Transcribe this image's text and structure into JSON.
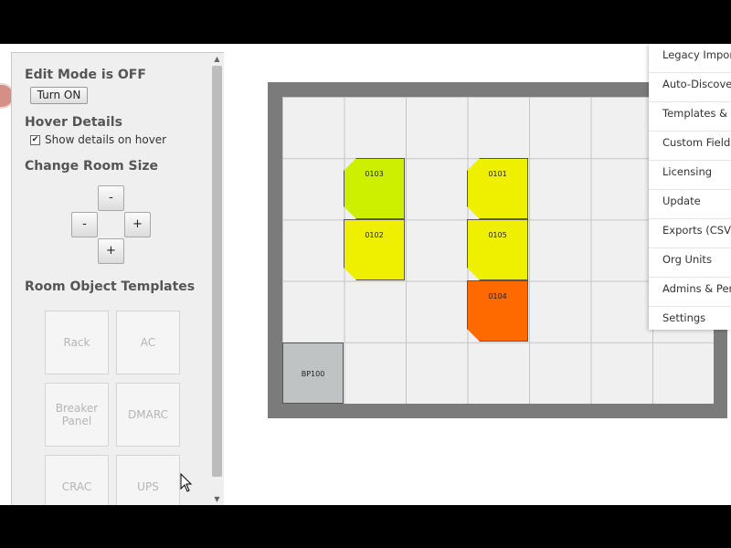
{
  "left_panel": {
    "edit_mode_title": "Edit Mode is OFF",
    "turn_on_label": "Turn ON",
    "hover_title": "Hover Details",
    "hover_checkbox_label": "Show details on hover",
    "hover_checked": true,
    "room_size_title": "Change Room Size",
    "size_buttons": {
      "up": "-",
      "left": "-",
      "right": "+",
      "down": "+"
    },
    "templates_title": "Room Object Templates",
    "templates": [
      "Rack",
      "AC",
      "Breaker\nPanel",
      "DMARC",
      "CRAC",
      "UPS"
    ]
  },
  "room": {
    "objects": [
      {
        "label": "0103",
        "color": "#ccf000"
      },
      {
        "label": "0101",
        "color": "#eef000"
      },
      {
        "label": "0102",
        "color": "#eef000"
      },
      {
        "label": "0105",
        "color": "#eef000"
      },
      {
        "label": "0104",
        "color": "#ff6a00"
      },
      {
        "label": "BP100",
        "color": "#bfc3c3"
      }
    ]
  },
  "menu": {
    "items": [
      "Legacy Import",
      "Auto-Discovery",
      "Templates & Profiles",
      "Custom Fields",
      "Licensing",
      "Update",
      "Exports (CSV)",
      "Org Units",
      "Admins & Permissions",
      "Settings"
    ]
  }
}
